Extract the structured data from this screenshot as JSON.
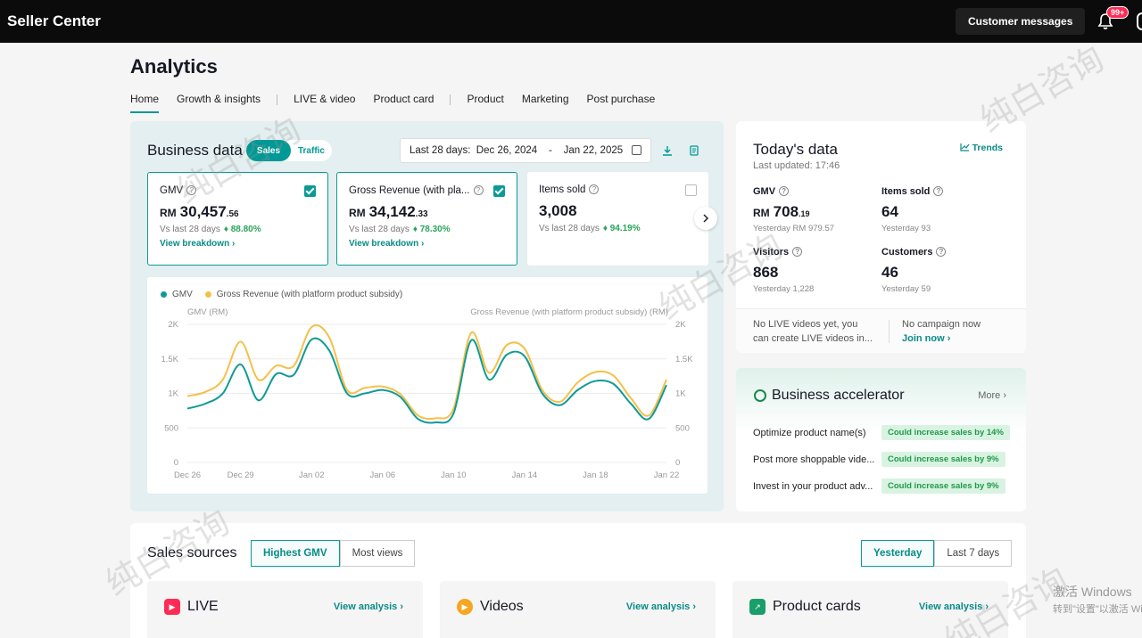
{
  "topbar": {
    "brand": "Seller Center",
    "customer_messages": "Customer messages",
    "notifications_badge": "99+"
  },
  "page": {
    "title": "Analytics",
    "tabs": [
      {
        "label": "Home",
        "active": true
      },
      {
        "label": "Growth & insights"
      },
      {
        "label": "LIVE & video"
      },
      {
        "label": "Product card"
      },
      {
        "label": "Product"
      },
      {
        "label": "Marketing"
      },
      {
        "label": "Post purchase"
      }
    ]
  },
  "business_data": {
    "title": "Business data",
    "toggle": {
      "sales": "Sales",
      "traffic": "Traffic"
    },
    "date_range": {
      "label": "Last 28 days:",
      "start": "Dec 26, 2024",
      "sep": "-",
      "end": "Jan 22, 2025"
    },
    "metrics": [
      {
        "label": "GMV",
        "currency": "RM",
        "value": "30,457",
        "decimals": ".56",
        "vs_label": "Vs last 28 days",
        "change": "88.80%",
        "breakdown": "View breakdown ›",
        "checked": true
      },
      {
        "label": "Gross Revenue (with pla...",
        "currency": "RM",
        "value": "34,142",
        "decimals": ".33",
        "vs_label": "Vs last 28 days",
        "change": "78.30%",
        "breakdown": "View breakdown ›",
        "checked": true
      },
      {
        "label": "Items sold",
        "currency": "",
        "value": "3,008",
        "decimals": "",
        "vs_label": "Vs last 28 days",
        "change": "94.19%",
        "checked": false
      }
    ],
    "colors": {
      "accent": "#009995",
      "gmv_line": "#0f9a96",
      "revenue_line": "#f5c04a"
    }
  },
  "chart_data": {
    "type": "line",
    "legend": [
      "GMV",
      "Gross Revenue (with platform product subsidy)"
    ],
    "ylabel_left": "GMV (RM)",
    "ylabel_right": "Gross Revenue (with platform product subsidy) (RM)",
    "ylim": [
      0,
      2000
    ],
    "y_ticks": [
      "0",
      "500",
      "1K",
      "1.5K",
      "2K"
    ],
    "x_tick_labels": [
      "Dec 26",
      "Dec 29",
      "Jan 02",
      "Jan 06",
      "Jan 10",
      "Jan 14",
      "Jan 18",
      "Jan 22"
    ],
    "x": [
      "Dec 26",
      "Dec 27",
      "Dec 28",
      "Dec 29",
      "Dec 30",
      "Dec 31",
      "Jan 01",
      "Jan 02",
      "Jan 03",
      "Jan 04",
      "Jan 05",
      "Jan 06",
      "Jan 07",
      "Jan 08",
      "Jan 09",
      "Jan 10",
      "Jan 11",
      "Jan 12",
      "Jan 13",
      "Jan 14",
      "Jan 15",
      "Jan 16",
      "Jan 17",
      "Jan 18",
      "Jan 19",
      "Jan 20",
      "Jan 21",
      "Jan 22"
    ],
    "series": [
      {
        "name": "GMV",
        "values": [
          780,
          850,
          1000,
          1420,
          900,
          1280,
          1270,
          1780,
          1620,
          1000,
          1000,
          1050,
          950,
          630,
          580,
          710,
          1770,
          1200,
          1560,
          1540,
          1000,
          830,
          1050,
          1180,
          1140,
          850,
          630,
          1120
        ]
      },
      {
        "name": "Gross Revenue (with platform product subsidy)",
        "values": [
          960,
          1020,
          1200,
          1750,
          1200,
          1400,
          1400,
          1960,
          1810,
          1050,
          1080,
          1100,
          990,
          680,
          640,
          780,
          1880,
          1300,
          1700,
          1650,
          1050,
          880,
          1160,
          1310,
          1260,
          930,
          680,
          1200
        ]
      }
    ]
  },
  "today": {
    "title": "Today's data",
    "trends": "Trends",
    "last_updated": "Last updated: 17:46",
    "cells": [
      {
        "label": "GMV",
        "currency": "RM",
        "value": "708",
        "decimals": ".19",
        "sub": "Yesterday RM 979.57"
      },
      {
        "label": "Items sold",
        "value": "64",
        "sub": "Yesterday 93"
      },
      {
        "label": "Visitors",
        "value": "868",
        "sub": "Yesterday 1,228"
      },
      {
        "label": "Customers",
        "value": "46",
        "sub": "Yesterday 59"
      }
    ],
    "footer_left_1": "No LIVE videos yet, you",
    "footer_left_2": "can create LIVE videos in...",
    "footer_right_1": "No campaign now",
    "footer_right_2": "Join now ›"
  },
  "accelerator": {
    "title": "Business accelerator",
    "more": "More ›",
    "rows": [
      {
        "text": "Optimize product name(s)",
        "tag": "Could increase sales by 14%"
      },
      {
        "text": "Post more shoppable vide...",
        "tag": "Could increase sales by 9%"
      },
      {
        "text": "Invest in your product adv...",
        "tag": "Could increase sales by 9%"
      }
    ]
  },
  "sources": {
    "title": "Sales sources",
    "sort": {
      "highest_gmv": "Highest GMV",
      "most_views": "Most views"
    },
    "period": {
      "yesterday": "Yesterday",
      "last7": "Last 7 days"
    },
    "cards": [
      {
        "name": "LIVE",
        "link": "View analysis ›",
        "color": "#fe2c55"
      },
      {
        "name": "Videos",
        "link": "View analysis ›",
        "color": "#f5a623"
      },
      {
        "name": "Product cards",
        "link": "View analysis ›",
        "color": "#1a9e6a"
      }
    ]
  },
  "watermark": {
    "text": "纯白咨询",
    "windows_1": "激活 Windows",
    "windows_2": "转到\"设置\"以激活 Windows"
  }
}
